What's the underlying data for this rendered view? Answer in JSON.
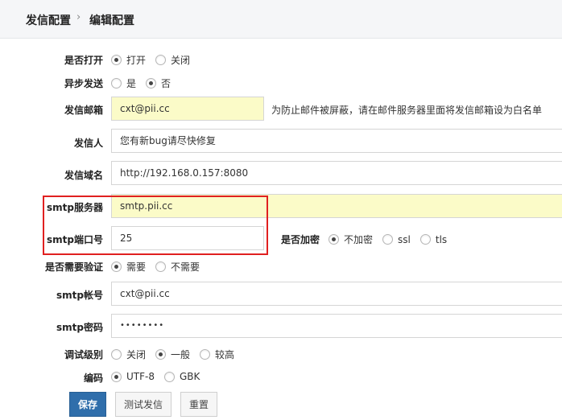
{
  "breadcrumb": {
    "parent": "发信配置",
    "separator": "›",
    "current": "编辑配置"
  },
  "fields": {
    "enable": {
      "label": "是否打开",
      "options": [
        "打开",
        "关闭"
      ],
      "selected": "打开"
    },
    "async": {
      "label": "异步发送",
      "options": [
        "是",
        "否"
      ],
      "selected": "否"
    },
    "sender_email": {
      "label": "发信邮箱",
      "value": "cxt@pii.cc",
      "hint": "为防止邮件被屏蔽，请在邮件服务器里面将发信邮箱设为白名单"
    },
    "sender_name": {
      "label": "发信人",
      "value": "您有新bug请尽快修复"
    },
    "sender_domain": {
      "label": "发信域名",
      "value": "http://192.168.0.157:8080"
    },
    "smtp_server": {
      "label": "smtp服务器",
      "value": "smtp.pii.cc"
    },
    "smtp_port": {
      "label": "smtp端口号",
      "value": "25"
    },
    "encryption": {
      "label": "是否加密",
      "options": [
        "不加密",
        "ssl",
        "tls"
      ],
      "selected": "不加密"
    },
    "need_auth": {
      "label": "是否需要验证",
      "options": [
        "需要",
        "不需要"
      ],
      "selected": "需要"
    },
    "smtp_account": {
      "label": "smtp帐号",
      "value": "cxt@pii.cc"
    },
    "smtp_password": {
      "label": "smtp密码",
      "value": "••••••••"
    },
    "debug_level": {
      "label": "调试级别",
      "options": [
        "关闭",
        "一般",
        "较高"
      ],
      "selected": "一般"
    },
    "charset": {
      "label": "编码",
      "options": [
        "UTF-8",
        "GBK"
      ],
      "selected": "UTF-8"
    }
  },
  "buttons": {
    "save": "保存",
    "test": "测试发信",
    "reset": "重置"
  },
  "colors": {
    "primary_button": "#2f6eab",
    "highlight_input": "#fbfbc8",
    "annotation_box": "#e02020"
  }
}
